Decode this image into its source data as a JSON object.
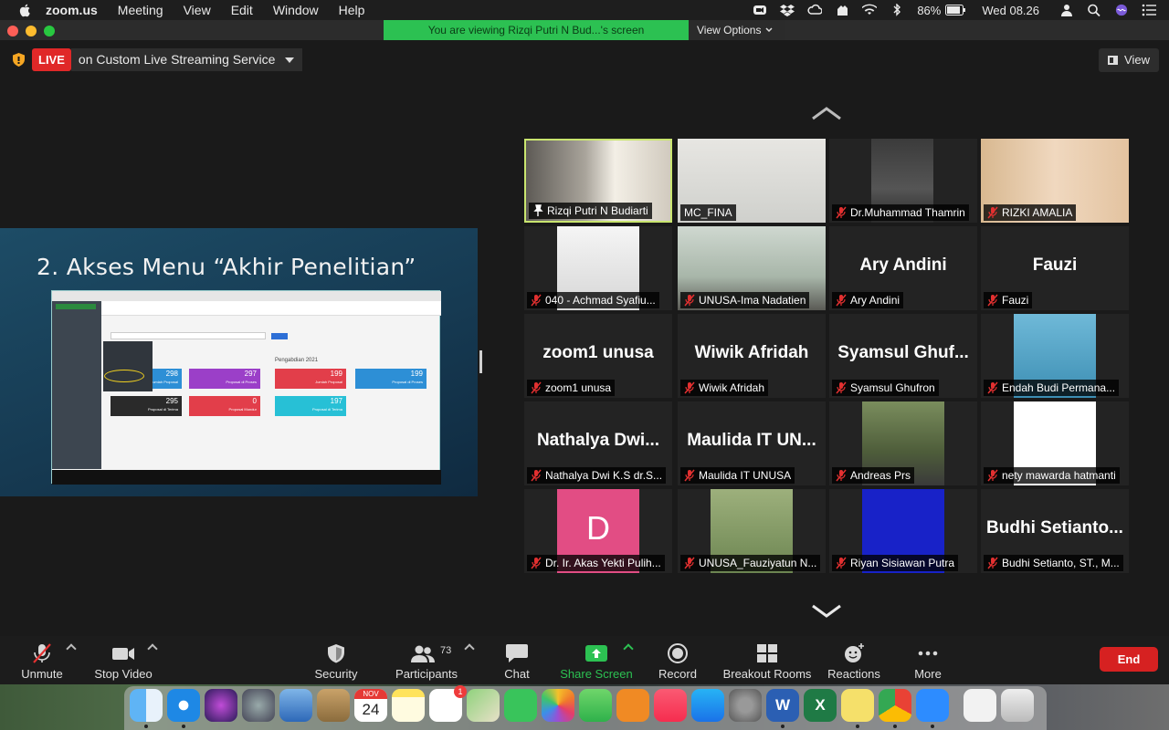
{
  "menubar": {
    "app_name": "zoom.us",
    "items": [
      "Meeting",
      "View",
      "Edit",
      "Window",
      "Help"
    ],
    "battery": "86%",
    "clock": "Wed 08.26"
  },
  "banner": {
    "viewing_text": "You are viewing Rizqi Putri N Bud...'s screen",
    "view_options": "View Options"
  },
  "live": {
    "badge": "LIVE",
    "service": "on Custom Live Streaming Service"
  },
  "view_button": "View",
  "shared_screen": {
    "slide_title": "2. Akses Menu “Akhir Penelitian”",
    "pengabdian_label": "Pengabdian 2021",
    "stat_values": [
      "298",
      "297",
      "199",
      "199",
      "295",
      "0",
      "197"
    ],
    "stat_labels": [
      "Jumlah Proposal",
      "Proposal di Proses",
      "Jumlah Proposal",
      "Proposal di Proses",
      "Proposal di Terima",
      "Proposal Mundur",
      "Proposal di Terima"
    ],
    "stat_colors": [
      "#2d8fd6",
      "#9b3fc8",
      "#e23e4a",
      "#2d8fd6",
      "#2a2a2a",
      "#e23e4a",
      "#27c0d6"
    ]
  },
  "participants_tiles": [
    {
      "name": "Rizqi Putri N Budiarti",
      "display": "",
      "has_video": true,
      "active": true,
      "muted": false,
      "pinned": true
    },
    {
      "name": "MC_FINA",
      "display": "",
      "has_video": true,
      "active": false,
      "muted": false
    },
    {
      "name": "Dr.Muhammad Thamrin",
      "display": "",
      "has_video": true,
      "active": false,
      "muted": true
    },
    {
      "name": "RIZKI AMALIA",
      "display": "",
      "has_video": true,
      "active": false,
      "muted": true
    },
    {
      "name": "040 - Achmad Syafiu...",
      "display": "",
      "has_video": true,
      "active": false,
      "muted": true
    },
    {
      "name": "UNUSA-Ima Nadatien",
      "display": "",
      "has_video": true,
      "active": false,
      "muted": true
    },
    {
      "name": "Ary Andini",
      "display": "Ary Andini",
      "has_video": false,
      "active": false,
      "muted": true
    },
    {
      "name": "Fauzi",
      "display": "Fauzi",
      "has_video": false,
      "active": false,
      "muted": true
    },
    {
      "name": "zoom1 unusa",
      "display": "zoom1 unusa",
      "has_video": false,
      "active": false,
      "muted": true
    },
    {
      "name": "Wiwik Afridah",
      "display": "Wiwik Afridah",
      "has_video": false,
      "active": false,
      "muted": true
    },
    {
      "name": "Syamsul Ghufron",
      "display": "Syamsul Ghuf...",
      "has_video": false,
      "active": false,
      "muted": true
    },
    {
      "name": "Endah Budi Permana...",
      "display": "",
      "has_video": true,
      "active": false,
      "muted": true
    },
    {
      "name": "Nathalya Dwi K.S dr.S...",
      "display": "Nathalya Dwi...",
      "has_video": false,
      "active": false,
      "muted": true
    },
    {
      "name": "Maulida IT UNUSA",
      "display": "Maulida IT UN...",
      "has_video": false,
      "active": false,
      "muted": true
    },
    {
      "name": "Andreas Prs",
      "display": "",
      "has_video": true,
      "active": false,
      "muted": true
    },
    {
      "name": "nety mawarda hatmanti",
      "display": "",
      "has_video": true,
      "active": false,
      "muted": true
    },
    {
      "name": "Dr. Ir. Akas Yekti Pulih...",
      "display": "D",
      "has_video": false,
      "active": false,
      "muted": true
    },
    {
      "name": "UNUSA_Fauziyatun N...",
      "display": "",
      "has_video": true,
      "active": false,
      "muted": true
    },
    {
      "name": "Riyan Sisiawan Putra",
      "display": "",
      "has_video": true,
      "active": false,
      "muted": true
    },
    {
      "name": "Budhi Setianto, ST., M...",
      "display": "Budhi Setianto...",
      "has_video": false,
      "active": false,
      "muted": true
    }
  ],
  "toolbar": {
    "unmute": "Unmute",
    "stop_video": "Stop Video",
    "security": "Security",
    "participants": "Participants",
    "participants_count": "73",
    "chat": "Chat",
    "share_screen": "Share Screen",
    "record": "Record",
    "breakout_rooms": "Breakout Rooms",
    "reactions": "Reactions",
    "more": "More",
    "end": "End"
  },
  "dock": {
    "calendar_month": "NOV",
    "calendar_day": "24",
    "reminders_badge": "1"
  },
  "colors": {
    "viewing_banner": "#2cc152",
    "live_red": "#e02828",
    "active_speaker_border": "#c9e56f",
    "share_green": "#2cc152",
    "end_red": "#d62121"
  }
}
